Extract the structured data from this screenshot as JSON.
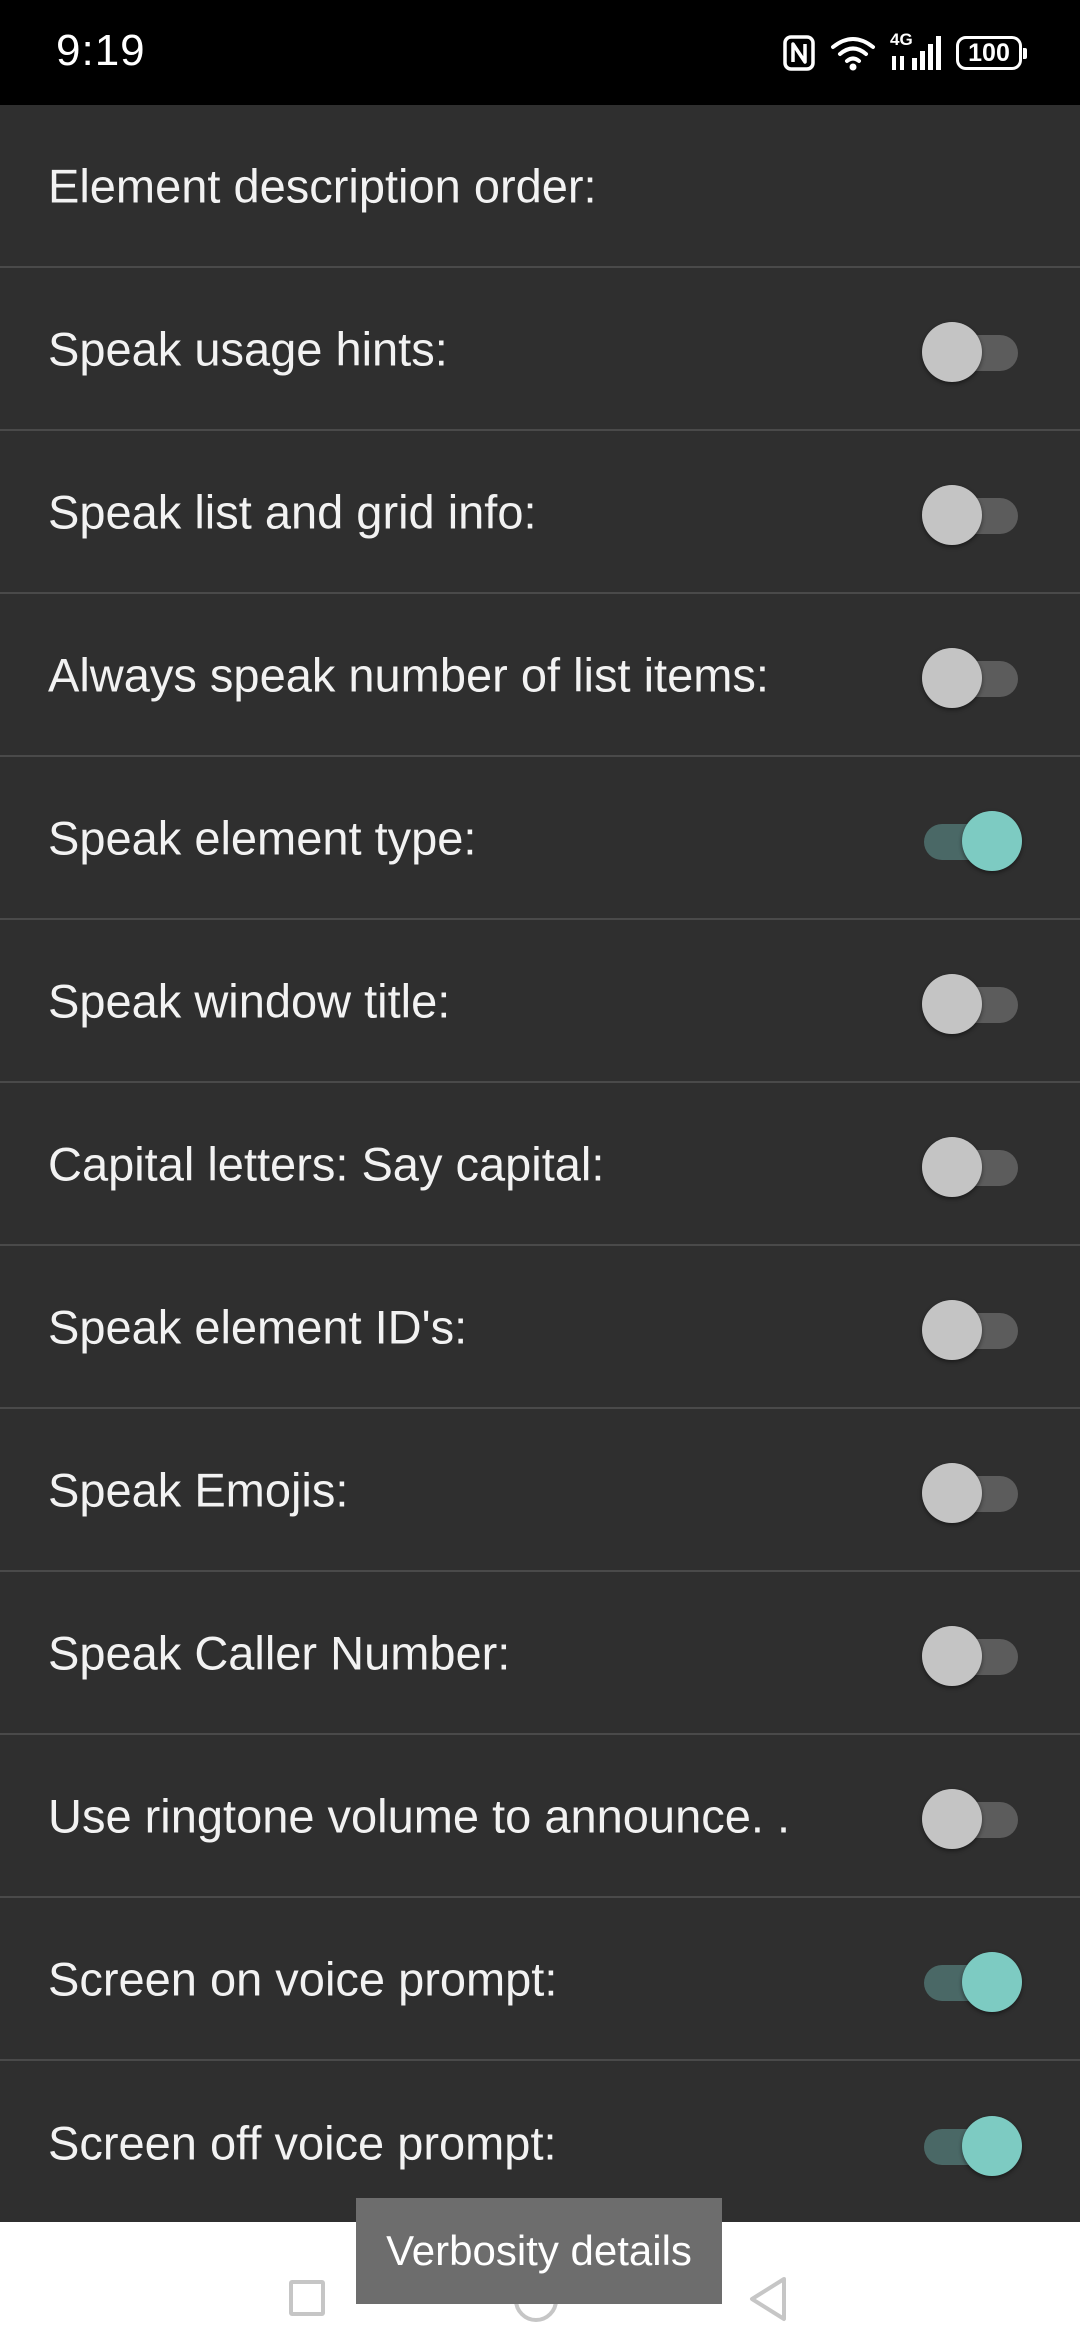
{
  "status_bar": {
    "time": "9:19",
    "network": "4G",
    "battery": "100"
  },
  "rows": [
    {
      "label": "Element description order:",
      "toggle": null
    },
    {
      "label": "Speak usage hints:",
      "toggle": false
    },
    {
      "label": "Speak list and grid info:",
      "toggle": false
    },
    {
      "label": "Always speak number of list items:",
      "toggle": false
    },
    {
      "label": "Speak element type:",
      "toggle": true
    },
    {
      "label": "Speak window title:",
      "toggle": false
    },
    {
      "label": "Capital letters: Say capital:",
      "toggle": false
    },
    {
      "label": "Speak element ID's:",
      "toggle": false
    },
    {
      "label": "Speak Emojis:",
      "toggle": false
    },
    {
      "label": "Speak Caller Number:",
      "toggle": false
    },
    {
      "label": "Use ringtone volume to announce. .",
      "toggle": false
    },
    {
      "label": "Screen on voice prompt:",
      "toggle": true
    },
    {
      "label": "Screen off voice prompt:",
      "toggle": true
    }
  ],
  "toast": {
    "text": "Verbosity details"
  },
  "colors": {
    "background": "#2f2f2f",
    "toggle_on_thumb": "#7dcbc2",
    "toggle_off_thumb": "#c4c4c4",
    "divider": "#4a4a4a"
  },
  "icons": [
    "nfc-icon",
    "wifi-icon",
    "signal-icon",
    "battery-icon",
    "recents-icon",
    "home-icon",
    "back-icon"
  ]
}
